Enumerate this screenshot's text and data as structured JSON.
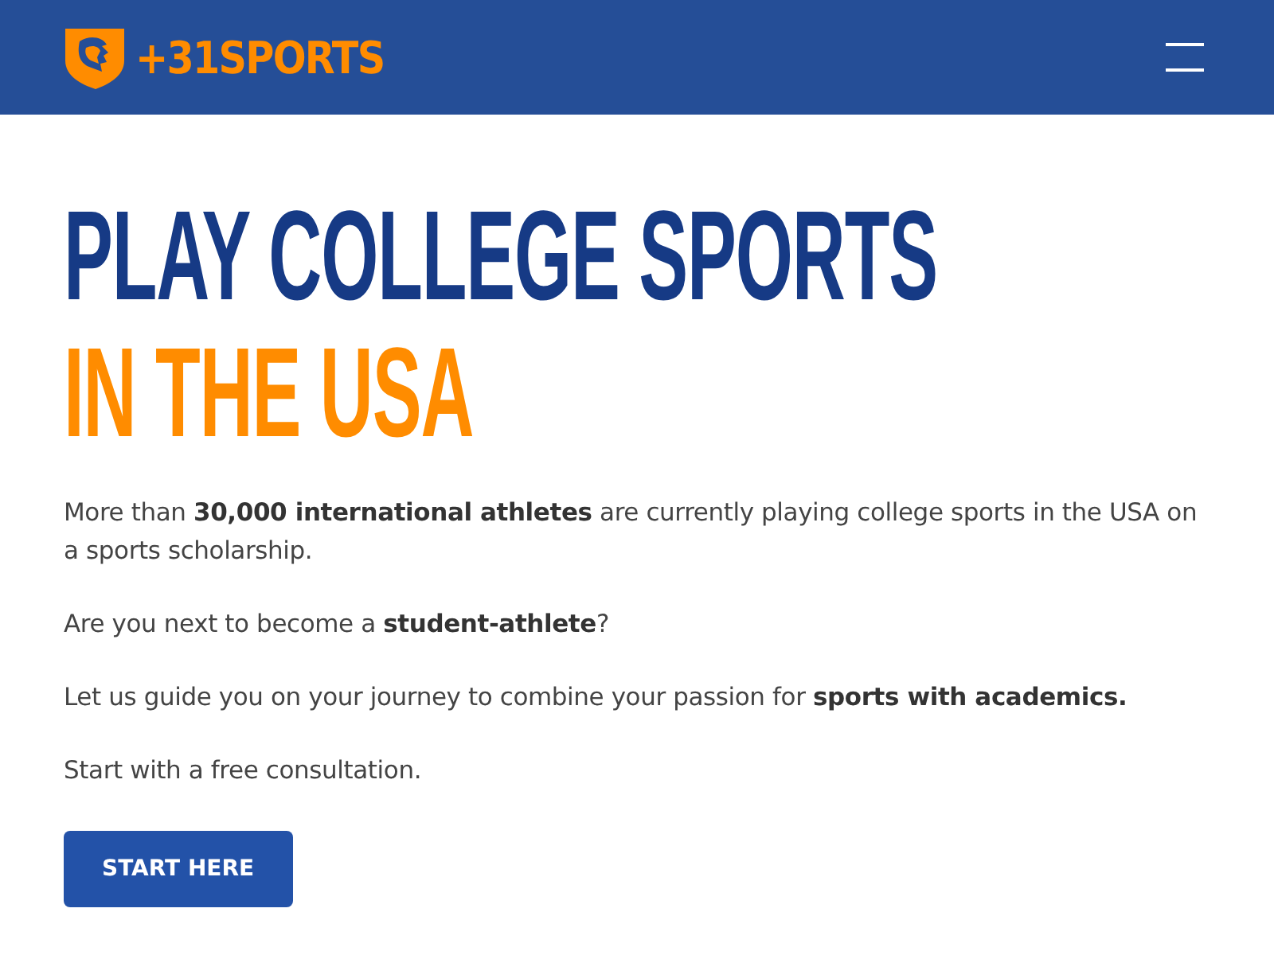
{
  "header": {
    "logo_text": "+31SPORTS"
  },
  "hero": {
    "title_line_1": "PLAY COLLEGE SPORTS",
    "title_line_2": "IN THE USA",
    "paragraphs": [
      "More than **30,000 international athletes** are currently playing college sports in the USA on a sports scholarship.",
      "Are you next to become a **student-athlete**?",
      "Let us guide you on your journey to combine your passion for **sports with academics.**",
      "Start with a free consultation."
    ],
    "button": "START HERE"
  }
}
